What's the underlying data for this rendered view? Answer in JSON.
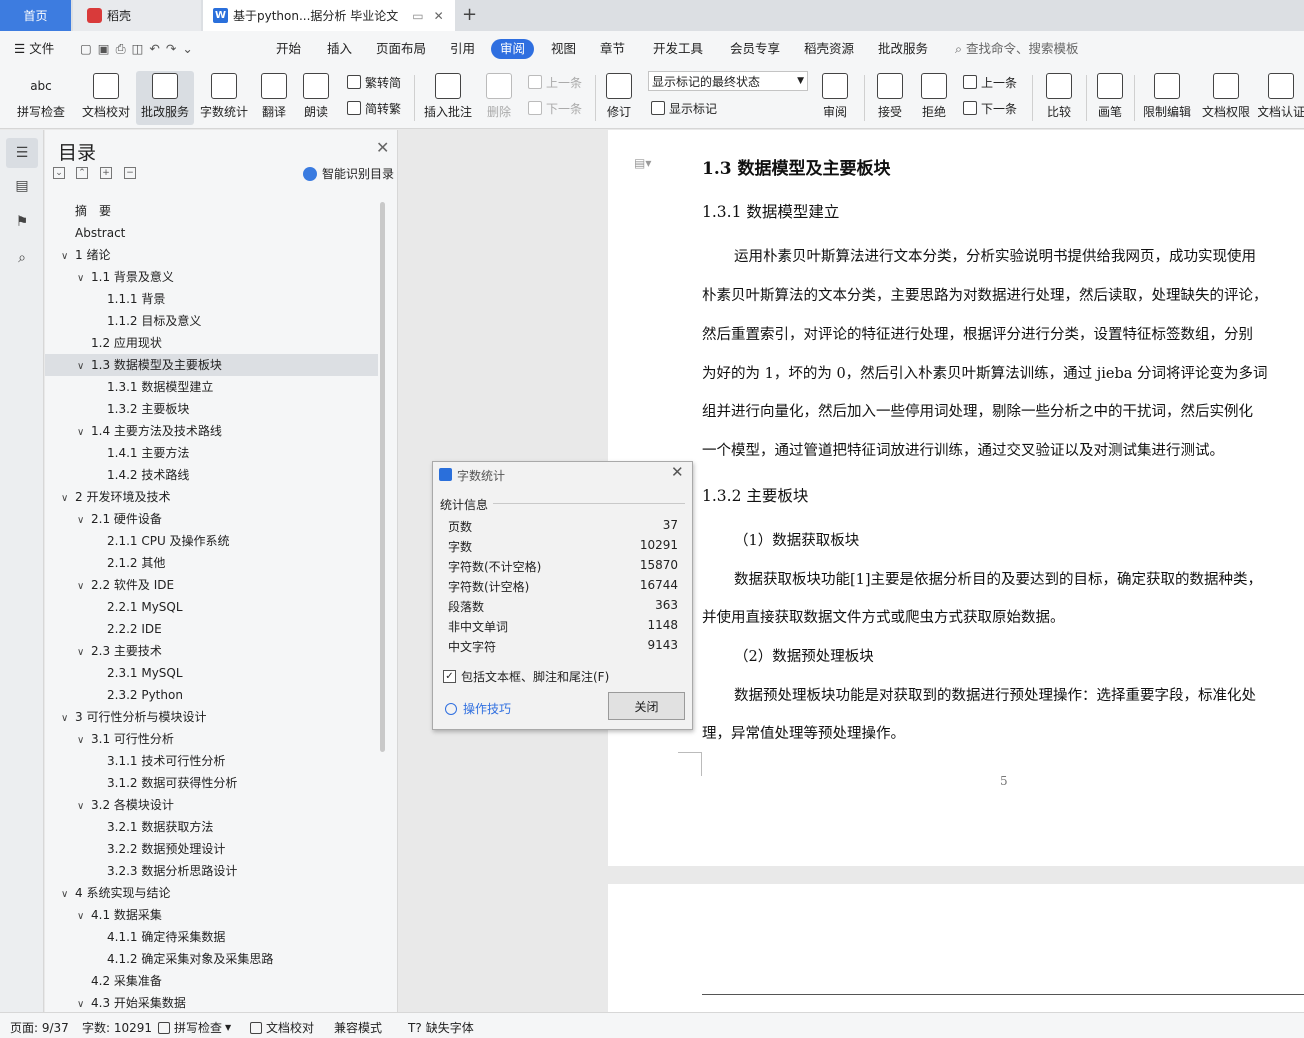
{
  "tabs": {
    "home": "首页",
    "daoke": "稻壳",
    "doc": "基于python...据分析 毕业论文"
  },
  "menu": {
    "file": "文件",
    "items": [
      "开始",
      "插入",
      "页面布局",
      "引用",
      "审阅",
      "视图",
      "章节",
      "开发工具",
      "会员专享",
      "稻壳资源",
      "批改服务"
    ],
    "search": "查找命令、搜索模板"
  },
  "ribbon": {
    "spell": "拼写检查",
    "proof": "文档校对",
    "grade": "批改服务",
    "count": "字数统计",
    "translate": "翻译",
    "read": "朗读",
    "trad": "繁转简",
    "simp": "简转繁",
    "insert_comment": "插入批注",
    "delete": "删除",
    "prev1": "上一条",
    "next1": "下一条",
    "track": "修订",
    "markup_state": "显示标记的最终状态",
    "show_markup": "显示标记",
    "review": "审阅",
    "accept": "接受",
    "reject": "拒绝",
    "prev2": "上一条",
    "next2": "下一条",
    "compare": "比较",
    "pen": "画笔",
    "restrict": "限制编辑",
    "perm": "文档权限",
    "cert": "文档认证"
  },
  "toc": {
    "title": "目录",
    "ai": "智能识别目录",
    "items": [
      "摘　要",
      "Abstract",
      "1 绪论",
      "1.1 背景及意义",
      "1.1.1 背景",
      "1.1.2 目标及意义",
      "1.2 应用现状",
      "1.3 数据模型及主要板块",
      "1.3.1 数据模型建立",
      "1.3.2 主要板块",
      "1.4 主要方法及技术路线",
      "1.4.1 主要方法",
      "1.4.2 技术路线",
      "2 开发环境及技术",
      "2.1 硬件设备",
      "2.1.1 CPU 及操作系统",
      "2.1.2 其他",
      "2.2 软件及 IDE",
      "2.2.1 MySQL",
      "2.2.2 IDE",
      "2.3 主要技术",
      "2.3.1 MySQL",
      "2.3.2 Python",
      "3 可行性分析与模块设计",
      "3.1 可行性分析",
      "3.1.1 技术可行性分析",
      "3.1.2 数据可获得性分析",
      "3.2 各模块设计",
      "3.2.1 数据获取方法",
      "3.2.2 数据预处理设计",
      "3.2.3 数据分析思路设计",
      "4 系统实现与结论",
      "4.1 数据采集",
      "4.1.1 确定待采集数据",
      "4.1.2 确定采集对象及采集思路",
      "4.2 采集准备",
      "4.3 开始采集数据"
    ]
  },
  "doc": {
    "h1": "1.3  数据模型及主要板块",
    "h2a": "1.3.1  数据模型建立",
    "para1": [
      "运用朴素贝叶斯算法进行文本分类，分析实验说明书提供给我网页，成功实现使用",
      "朴素贝叶斯算法的文本分类，主要思路为对数据进行处理，然后读取，处理缺失的评论，",
      "然后重置索引，对评论的特征进行处理，根据评分进行分类，设置特征标签数组，分别",
      "为好的为 1，坏的为 0，然后引入朴素贝叶斯算法训练，通过 jieba 分词将评论变为多词",
      "组并进行向量化，然后加入一些停用词处理，剔除一些分析之中的干扰词，然后实例化",
      "一个模型，通过管道把特征词放进行训练，通过交叉验证以及对测试集进行测试。"
    ],
    "h2b": "1.3.2  主要板块",
    "sub1": "（1）数据获取板块",
    "para2": [
      "数据获取板块功能[1]主要是依据分析目的及要达到的目标，确定获取的数据种类，",
      "并使用直接获取数据文件方式或爬虫方式获取原始数据。"
    ],
    "sub2": "（2）数据预处理板块",
    "para3": [
      "数据预处理板块功能是对获取到的数据进行预处理操作：选择重要字段，标准化处",
      "理，异常值处理等预处理操作。"
    ],
    "pagenum": "5"
  },
  "dialog": {
    "title": "字数统计",
    "section": "统计信息",
    "rows": [
      {
        "label": "页数",
        "value": "37"
      },
      {
        "label": "字数",
        "value": "10291"
      },
      {
        "label": "字符数(不计空格)",
        "value": "15870"
      },
      {
        "label": "字符数(计空格)",
        "value": "16744"
      },
      {
        "label": "段落数",
        "value": "363"
      },
      {
        "label": "非中文单词",
        "value": "1148"
      },
      {
        "label": "中文字符",
        "value": "9143"
      }
    ],
    "checkbox": "包括文本框、脚注和尾注(F)",
    "tips": "操作技巧",
    "close": "关闭"
  },
  "status": {
    "page": "页面: 9/37",
    "words": "字数: 10291",
    "spell": "拼写检查",
    "proof": "文档校对",
    "compat": "兼容模式",
    "font": "缺失字体"
  }
}
